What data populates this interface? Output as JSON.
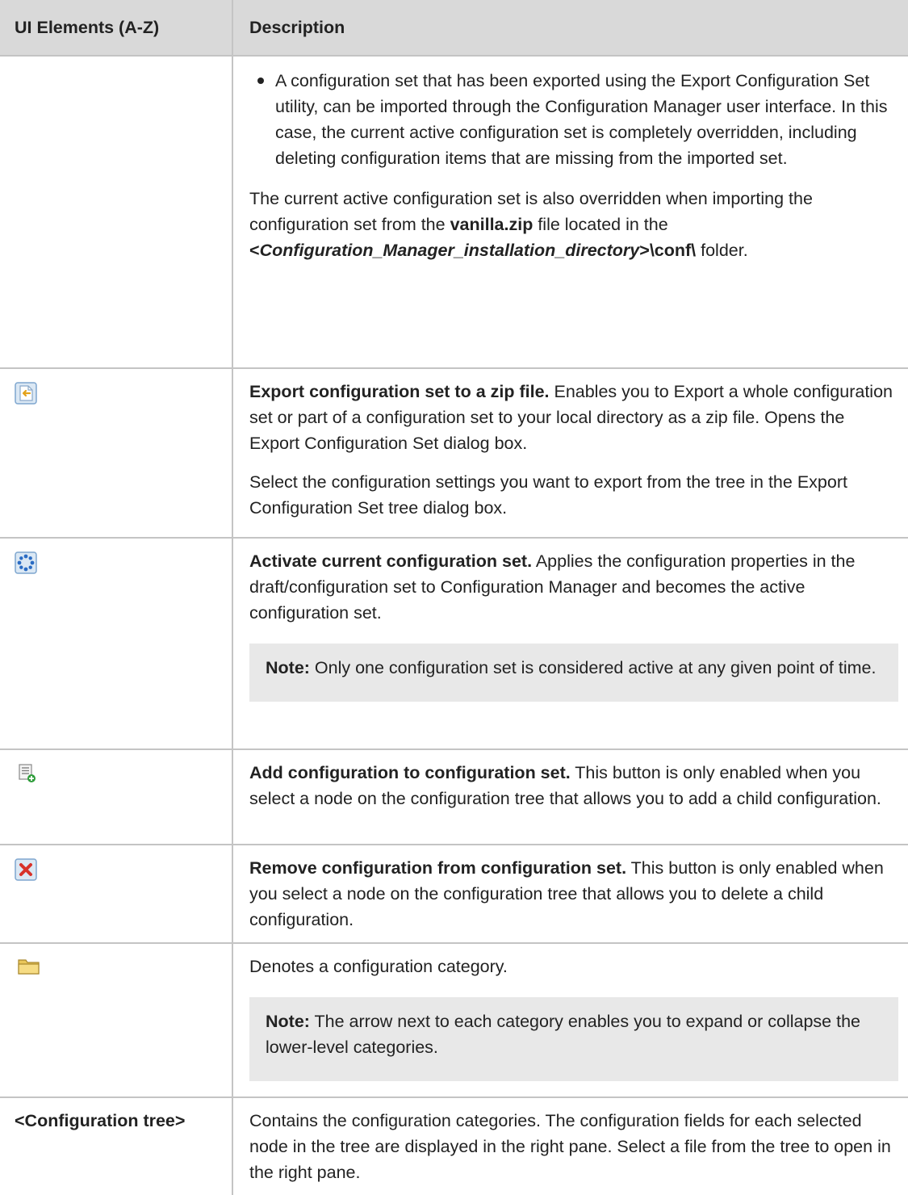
{
  "header": {
    "col1": "UI Elements (A-Z)",
    "col2": "Description"
  },
  "rows": {
    "import": {
      "bullet": "A configuration set that has been exported using the Export Configuration Set utility, can be imported through the Configuration Manager user interface. In this case, the current active configuration set is completely overridden, including deleting configuration items that are missing from the imported set.",
      "p2_a": "The current active configuration set is also overridden when importing the configuration set from the ",
      "p2_file": "vanilla.zip",
      "p2_b": " file located in the ",
      "p2_lt": "<",
      "p2_dir": "Configuration_Manager_installation_directory",
      "p2_gt": ">\\conf\\",
      "p2_c": " folder."
    },
    "export": {
      "icon": "export-zip-icon",
      "title": "Export configuration set to a zip file.",
      "desc": " Enables you to Export a whole configuration set or part of a configuration set to your local directory as a zip file. Opens the Export Configuration Set dialog box.",
      "p2": "Select the configuration settings you want to export from the tree in the Export Configuration Set tree dialog box."
    },
    "activate": {
      "icon": "activate-gear-icon",
      "title": "Activate current configuration set.",
      "desc": " Applies the configuration properties in the draft/configuration set to Configuration Manager and becomes the active configuration set.",
      "note_label": "Note:",
      "note_text": " Only one configuration set is considered active at any given point of time."
    },
    "add": {
      "icon": "add-configuration-icon",
      "title": "Add configuration to configuration set.",
      "desc": " This button is only enabled when you select a node on the configuration tree that allows you to add a child configuration."
    },
    "remove": {
      "icon": "remove-x-icon",
      "title": "Remove configuration from configuration set.",
      "desc": " This button is only enabled when you select a node on the configuration tree that allows you to delete a child configuration."
    },
    "category": {
      "icon": "folder-icon",
      "desc": "Denotes a configuration category.",
      "note_label": "Note:",
      "note_text": " The arrow next to each category enables you to expand or collapse the lower-level categories."
    },
    "tree": {
      "label": "<Configuration tree>",
      "desc": "Contains the configuration categories. The configuration fields for each selected node in the tree are displayed in the right pane. Select a file from the tree to open in the right pane."
    }
  },
  "colors": {
    "header_bg": "#d9d9d9",
    "note_bg": "#e8e8e8",
    "border": "#c4c4c4"
  }
}
